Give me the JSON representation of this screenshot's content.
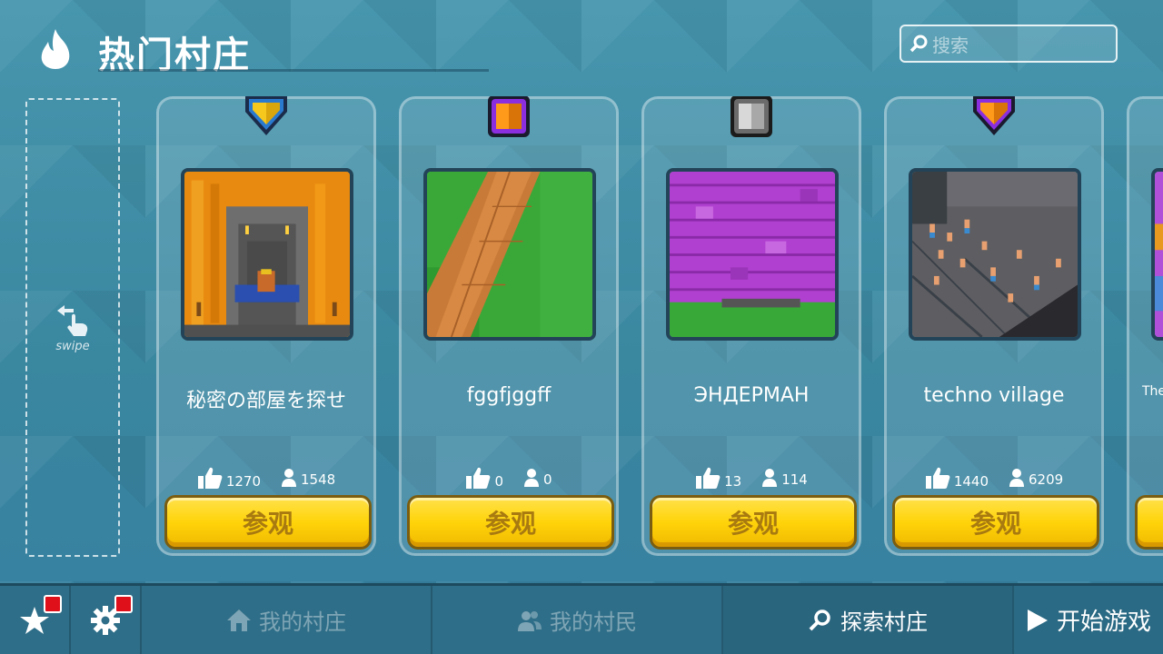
{
  "header": {
    "title": "热门村庄",
    "search_placeholder": "搜索"
  },
  "swipe": {
    "label": "swipe"
  },
  "cards": [
    {
      "badge_colors": [
        "#f6c81e",
        "#2a7ad0"
      ],
      "name": "秘密の部屋を探せ",
      "likes": "1270",
      "players": "1548",
      "button_label": "参观"
    },
    {
      "badge_colors": [
        "#ff9a1a",
        "#8a2ee0"
      ],
      "name": "fggfjggff",
      "likes": "0",
      "players": "0",
      "button_label": "参观"
    },
    {
      "badge_colors": [
        "#d8d8d8",
        "#6b6b6b"
      ],
      "name": "ЭНДЕРМАН",
      "likes": "13",
      "players": "114",
      "button_label": "参观"
    },
    {
      "badge_colors": [
        "#ff9a1a",
        "#8a2ee0"
      ],
      "name": "techno village",
      "likes": "1440",
      "players": "6209",
      "button_label": "参观"
    },
    {
      "name": "The"
    }
  ],
  "bottom_bar": {
    "tabs": [
      {
        "label": "我的村庄",
        "icon": "home-icon"
      },
      {
        "label": "我的村民",
        "icon": "villagers-icon"
      },
      {
        "label": "探索村庄",
        "icon": "search-icon"
      }
    ],
    "start_label": "开始游戏"
  },
  "colors": {
    "background": "#3c8aa3",
    "button_yellow": "#ffd40a",
    "notification_red": "#e0101a"
  }
}
